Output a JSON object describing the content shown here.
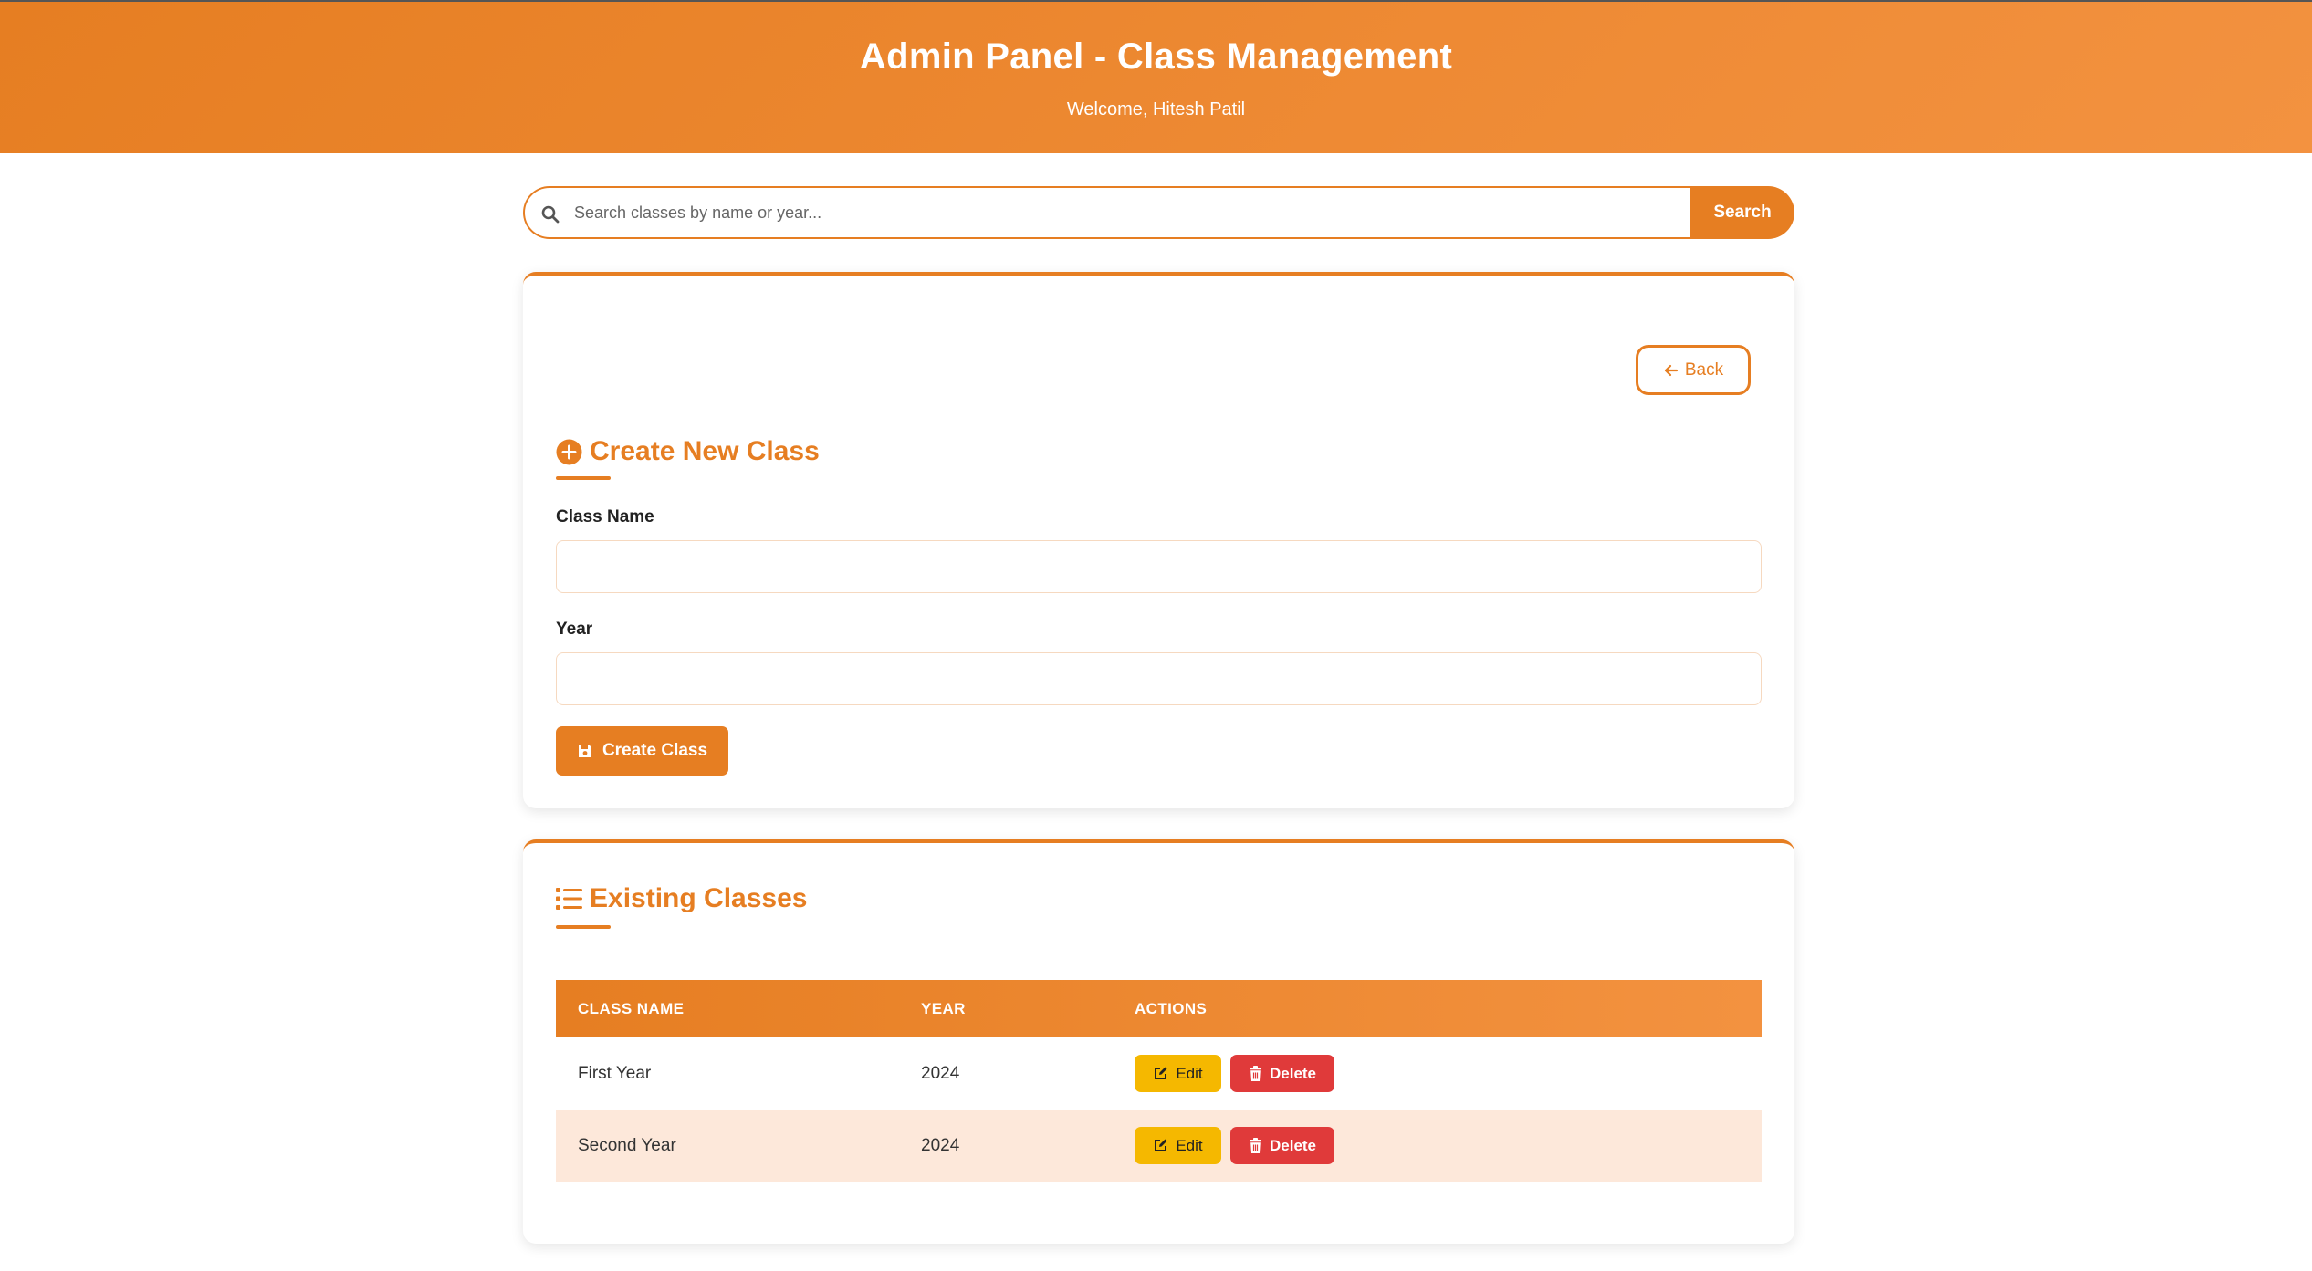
{
  "header": {
    "title": "Admin Panel - Class Management",
    "welcome": "Welcome, Hitesh Patil"
  },
  "search": {
    "placeholder": "Search classes by name or year...",
    "value": "",
    "button_label": "Search"
  },
  "create_card": {
    "back_label": "Back",
    "title": "Create New Class",
    "fields": [
      {
        "label": "Class Name",
        "value": ""
      },
      {
        "label": "Year",
        "value": ""
      }
    ],
    "submit_label": "Create Class"
  },
  "list_card": {
    "title": "Existing Classes",
    "columns": [
      "CLASS NAME",
      "YEAR",
      "ACTIONS"
    ],
    "rows": [
      {
        "name": "First Year",
        "year": "2024",
        "edit": "Edit",
        "delete": "Delete"
      },
      {
        "name": "Second Year",
        "year": "2024",
        "edit": "Edit",
        "delete": "Delete"
      }
    ]
  },
  "colors": {
    "accent": "#e67e22",
    "accent_light": "#f39240",
    "row_alt": "#fde8da",
    "edit": "#f5b800",
    "delete": "#e03a3a"
  },
  "icons": {
    "search": "search-icon",
    "back": "arrow-left-icon",
    "create": "plus-circle-icon",
    "save": "save-icon",
    "list": "list-icon",
    "edit": "edit-icon",
    "delete": "trash-icon"
  }
}
